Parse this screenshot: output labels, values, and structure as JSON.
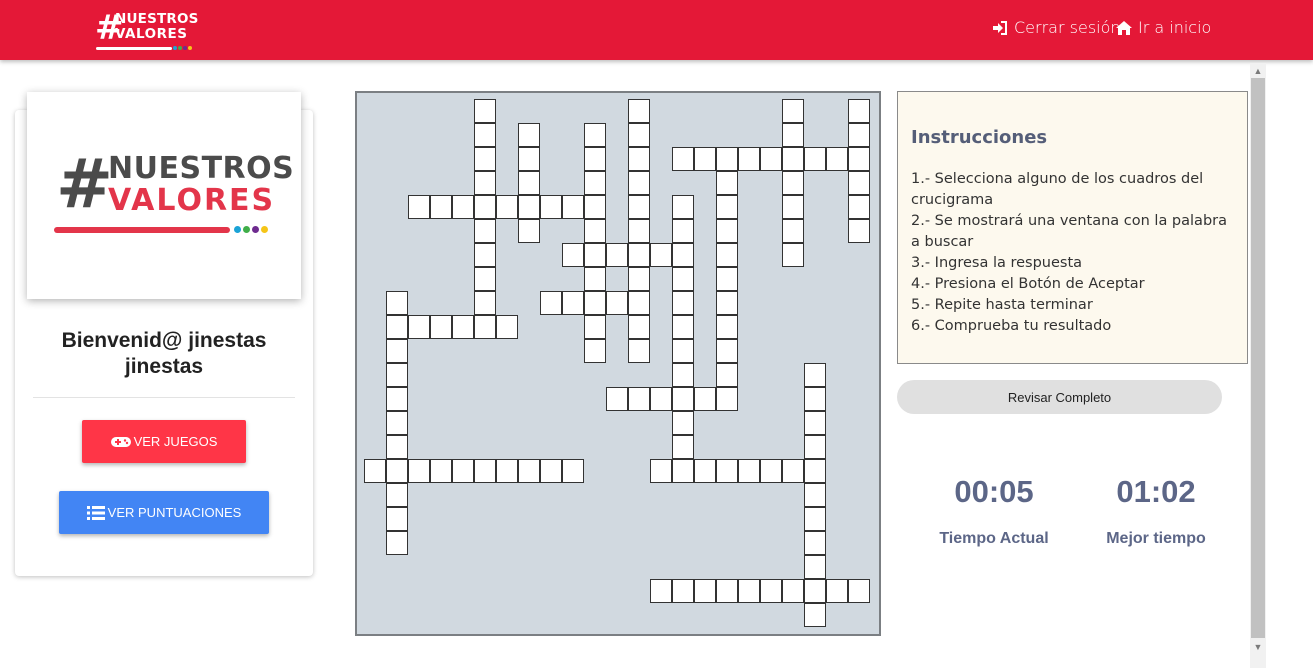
{
  "header": {
    "brand_line1": "NUESTROS",
    "brand_line2": "VALORES",
    "logout_label": "Cerrar sesión",
    "home_label": "Ir a inicio",
    "colors": {
      "bar": "#e41837"
    }
  },
  "sidebar": {
    "logo_hash": "#",
    "logo_line1": "NUESTROS",
    "logo_line2": "VALORES",
    "welcome_line1": "Bienvenid@ jinestas",
    "welcome_line2": "jinestas",
    "games_button": "VER JUEGOS",
    "scores_button": "VER PUNTUACIONES",
    "logo_dot_colors": [
      "#e41837",
      "#1ba3d6",
      "#3fae49",
      "#6e2b8f",
      "#f5c518"
    ]
  },
  "instructions": {
    "title": "Instrucciones",
    "items": [
      "1.- Selecciona alguno de los cuadros del crucigrama",
      "2.- Se mostrará una ventana con la palabra a buscar",
      "3.- Ingresa la respuesta",
      "4.- Presiona el Botón de Aceptar",
      "5.- Repite hasta terminar",
      "6.- Comprueba tu resultado"
    ]
  },
  "check_button": "Revisar Completo",
  "timers": {
    "current_value": "00:05",
    "current_label": "Tiempo Actual",
    "best_value": "01:02",
    "best_label": "Mejor tiempo"
  },
  "crossword": {
    "words": [
      {
        "dir": "down",
        "col": 5,
        "row": 0,
        "len": 10
      },
      {
        "dir": "down",
        "col": 12,
        "row": 0,
        "len": 11
      },
      {
        "dir": "down",
        "col": 19,
        "row": 0,
        "len": 7
      },
      {
        "dir": "down",
        "col": 22,
        "row": 0,
        "len": 6
      },
      {
        "dir": "down",
        "col": 7,
        "row": 1,
        "len": 5
      },
      {
        "dir": "down",
        "col": 10,
        "row": 1,
        "len": 10
      },
      {
        "dir": "across",
        "col": 14,
        "row": 2,
        "len": 9
      },
      {
        "dir": "down",
        "col": 16,
        "row": 2,
        "len": 11
      },
      {
        "dir": "across",
        "col": 2,
        "row": 4,
        "len": 9
      },
      {
        "dir": "down",
        "col": 14,
        "row": 4,
        "len": 12
      },
      {
        "dir": "across",
        "col": 9,
        "row": 6,
        "len": 6
      },
      {
        "dir": "across",
        "col": 8,
        "row": 8,
        "len": 5
      },
      {
        "dir": "down",
        "col": 1,
        "row": 8,
        "len": 11
      },
      {
        "dir": "across",
        "col": 1,
        "row": 9,
        "len": 6
      },
      {
        "dir": "down",
        "col": 20,
        "row": 11,
        "len": 11
      },
      {
        "dir": "across",
        "col": 11,
        "row": 12,
        "len": 6
      },
      {
        "dir": "across",
        "col": 0,
        "row": 15,
        "len": 10
      },
      {
        "dir": "across",
        "col": 13,
        "row": 15,
        "len": 8
      },
      {
        "dir": "across",
        "col": 13,
        "row": 20,
        "len": 10
      }
    ]
  }
}
